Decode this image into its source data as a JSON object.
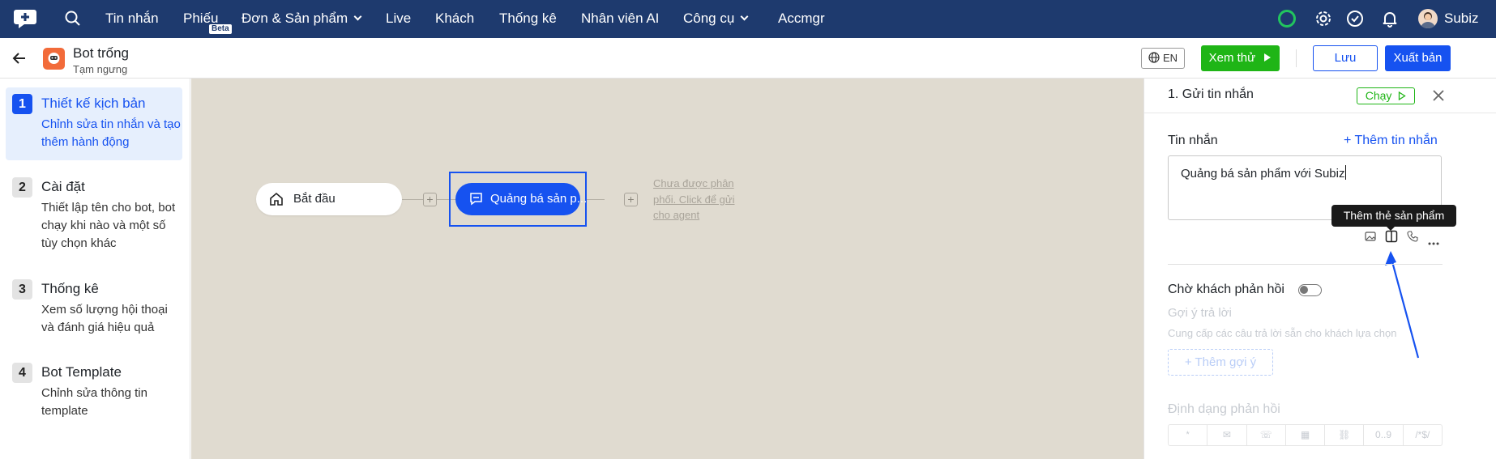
{
  "nav": {
    "items": [
      "Tin nhắn",
      "Phiếu",
      "Đơn & Sản phẩm",
      "Live",
      "Khách",
      "Thống kê",
      "Nhân viên AI",
      "Công cụ",
      "Accmgr"
    ],
    "beta": "Beta",
    "user": "Subiz",
    "status_color": "#22c55e"
  },
  "header": {
    "bot_name": "Bot trống",
    "bot_status": "Tạm ngưng",
    "lang": "EN",
    "preview_label": "Xem thử",
    "save_label": "Lưu",
    "publish_label": "Xuất bản"
  },
  "steps": [
    {
      "num": "1",
      "title": "Thiết kế kịch bản",
      "desc": "Chỉnh sửa tin nhắn và tạo thêm hành động",
      "active": true
    },
    {
      "num": "2",
      "title": "Cài đặt",
      "desc": "Thiết lập tên cho bot, bot chạy khi nào và một số tùy chọn khác",
      "active": false
    },
    {
      "num": "3",
      "title": "Thống kê",
      "desc": "Xem số lượng hội thoại và đánh giá hiệu quả",
      "active": false
    },
    {
      "num": "4",
      "title": "Bot Template",
      "desc": "Chỉnh sửa thông tin template",
      "active": false
    }
  ],
  "canvas": {
    "start_label": "Bắt đầu",
    "message_node": "Quảng bá sản p...",
    "unassigned": "Chưa được phân phối. Click để gửi cho agent"
  },
  "panel": {
    "title": "1. Gửi tin nhắn",
    "run_label": "Chạy",
    "message_section": "Tin nhắn",
    "add_message": "+ Thêm tin nhắn",
    "message_text": "Quảng bá sản phẩm với Subiz",
    "tooltip": "Thêm thẻ sản phẩm",
    "wait_reply": "Chờ khách phản hồi",
    "suggest_title": "Gợi ý trả lời",
    "suggest_desc": "Cung cấp các câu trả lời sẵn cho khách lựa chọn",
    "add_suggest": "+ Thêm gợi ý",
    "format_title": "Định dạng phản hồi",
    "format_options": [
      "*",
      "✉",
      "☏",
      "▦",
      "⛓",
      "0..9",
      "/*$/"
    ]
  },
  "colors": {
    "brand": "#1e3a6e",
    "primary": "#1652f0",
    "green": "#1fb516",
    "canvas": "#e0dbd0"
  }
}
